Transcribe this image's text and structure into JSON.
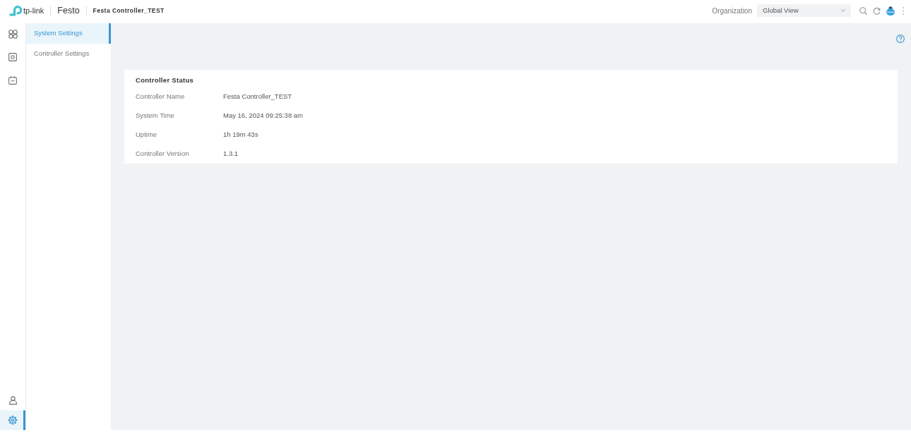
{
  "header": {
    "brand": "tp-link",
    "organization": "Festo",
    "site": "Festa Controller_TEST",
    "organization_label": "Organization",
    "organization_select": {
      "value": "Global View"
    }
  },
  "rail": {
    "top": [
      {
        "kind": "grid",
        "selected": false
      },
      {
        "kind": "device",
        "selected": false
      },
      {
        "kind": "calendar",
        "selected": false
      }
    ],
    "bottom": [
      {
        "kind": "user",
        "selected": false
      },
      {
        "kind": "settings",
        "selected": true
      }
    ]
  },
  "menu": [
    {
      "label": "System Settings",
      "selected": true
    },
    {
      "label": "Controller Settings",
      "selected": false
    }
  ],
  "card": {
    "title": "Controller Status",
    "fields": [
      {
        "label": "Controller Name",
        "value": "Festa Controller_TEST"
      },
      {
        "label": "System Time",
        "value": "May 16, 2024 09:25:38 am"
      },
      {
        "label": "Uptime",
        "value": "1h 19m 43s"
      },
      {
        "label": "Controller Version",
        "value": "1.3.1"
      }
    ]
  }
}
